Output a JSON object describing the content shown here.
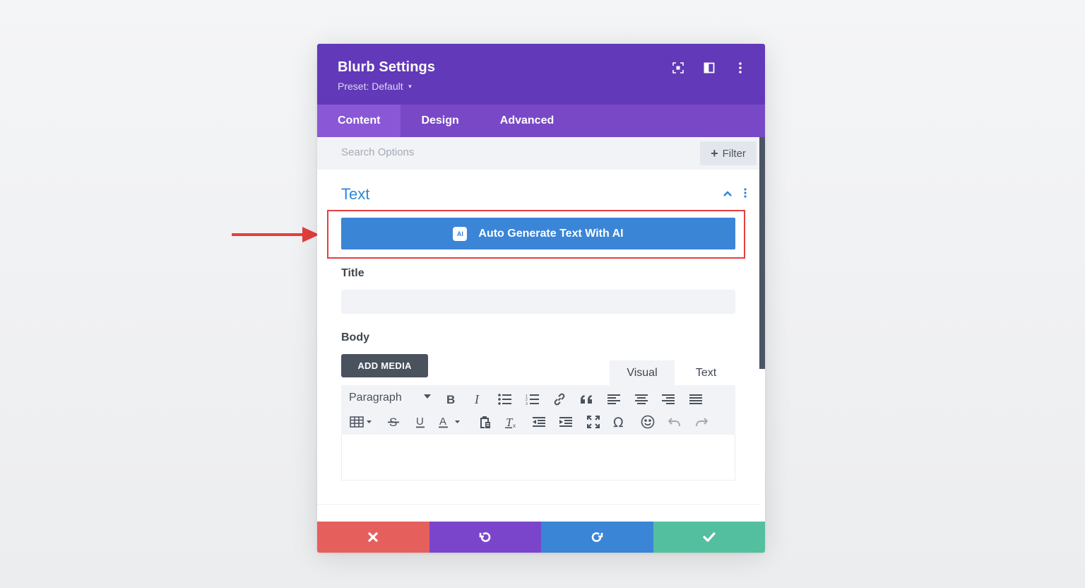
{
  "modal": {
    "title": "Blurb Settings",
    "preset_label": "Preset: Default",
    "header_icons": [
      "focus-icon",
      "split-view-icon",
      "more-vertical-icon"
    ]
  },
  "tabs": [
    {
      "label": "Content",
      "active": true
    },
    {
      "label": "Design",
      "active": false
    },
    {
      "label": "Advanced",
      "active": false
    }
  ],
  "search": {
    "placeholder": "Search Options",
    "filter_label": "Filter"
  },
  "section": {
    "title": "Text",
    "ai_button_label": "Auto Generate Text With AI",
    "ai_badge": "AI"
  },
  "fields": {
    "title_label": "Title",
    "title_value": "",
    "body_label": "Body",
    "add_media_label": "ADD MEDIA",
    "editor_tabs": [
      "Visual",
      "Text"
    ]
  },
  "toolbar": {
    "format_select": "Paragraph",
    "row1": [
      "bold-icon",
      "italic-icon",
      "bullet-list-icon",
      "numbered-list-icon",
      "link-icon",
      "blockquote-icon",
      "align-left-icon",
      "align-center-icon",
      "align-right-icon",
      "align-justify-icon"
    ],
    "row2": [
      "table-icon",
      "strikethrough-icon",
      "underline-icon",
      "text-color-icon",
      "paste-text-icon",
      "clear-formatting-icon",
      "outdent-icon",
      "indent-icon",
      "fullscreen-icon",
      "special-character-icon",
      "emoji-icon",
      "undo-icon",
      "redo-icon"
    ]
  },
  "footer": [
    "close-icon",
    "undo-icon",
    "redo-icon",
    "check-icon"
  ],
  "colors": {
    "header": "#6239b8",
    "tabs": "#7848c6",
    "active_tab": "#8a57d6",
    "accent_blue": "#3a85d6",
    "highlight_red": "#e53e3e",
    "cancel": "#e55f5d",
    "save": "#53bf9e"
  }
}
